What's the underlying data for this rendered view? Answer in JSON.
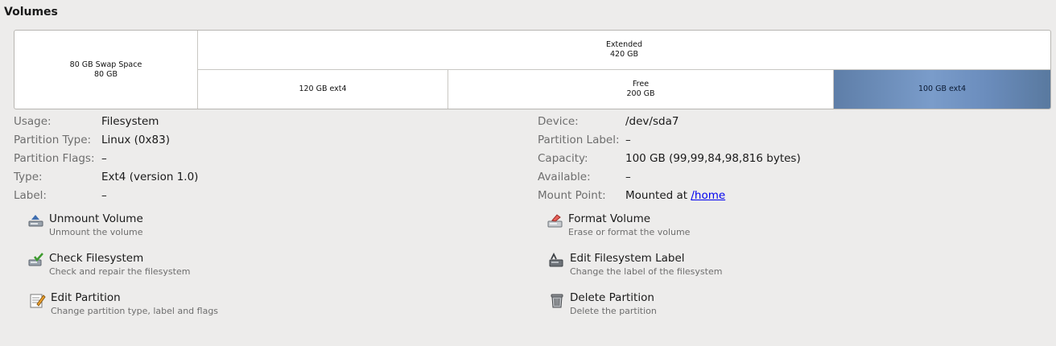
{
  "section_title": "Volumes",
  "volume_map": {
    "swap": {
      "name": "80 GB Swap Space",
      "size": "80 GB"
    },
    "extended": {
      "name": "Extended",
      "size": "420 GB"
    },
    "logical1": {
      "name": "120 GB ext4"
    },
    "free": {
      "name": "Free",
      "size": "200 GB"
    },
    "selected": {
      "name": "100 GB ext4"
    },
    "selected_color": "#6b8dbd"
  },
  "details_left": [
    {
      "label": "Usage:",
      "value": "Filesystem"
    },
    {
      "label": "Partition Type:",
      "value": "Linux (0x83)"
    },
    {
      "label": "Partition Flags:",
      "value": "–"
    },
    {
      "label": "Type:",
      "value": "Ext4 (version 1.0)"
    },
    {
      "label": "Label:",
      "value": "–"
    }
  ],
  "details_right": [
    {
      "label": "Device:",
      "value": "/dev/sda7"
    },
    {
      "label": "Partition Label:",
      "value": "–"
    },
    {
      "label": "Capacity:",
      "value": "100 GB (99,99,84,98,816 bytes)"
    },
    {
      "label": "Available:",
      "value": "–"
    },
    {
      "label": "Mount Point:",
      "value_prefix": "Mounted at ",
      "link": "/home"
    }
  ],
  "actions": {
    "unmount": {
      "title": "Unmount Volume",
      "desc": "Unmount the volume",
      "icon": "unmount-drive-icon"
    },
    "format": {
      "title": "Format Volume",
      "desc": "Erase or format the volume",
      "icon": "format-drive-icon"
    },
    "check": {
      "title": "Check Filesystem",
      "desc": "Check and repair the filesystem",
      "icon": "check-filesystem-icon"
    },
    "edit_label": {
      "title": "Edit Filesystem Label",
      "desc": "Change the label of the filesystem",
      "icon": "edit-label-icon"
    },
    "edit_partition": {
      "title": "Edit Partition",
      "desc": "Change partition type, label and flags",
      "icon": "edit-partition-icon"
    },
    "delete": {
      "title": "Delete Partition",
      "desc": "Delete the partition",
      "icon": "trash-icon"
    }
  }
}
